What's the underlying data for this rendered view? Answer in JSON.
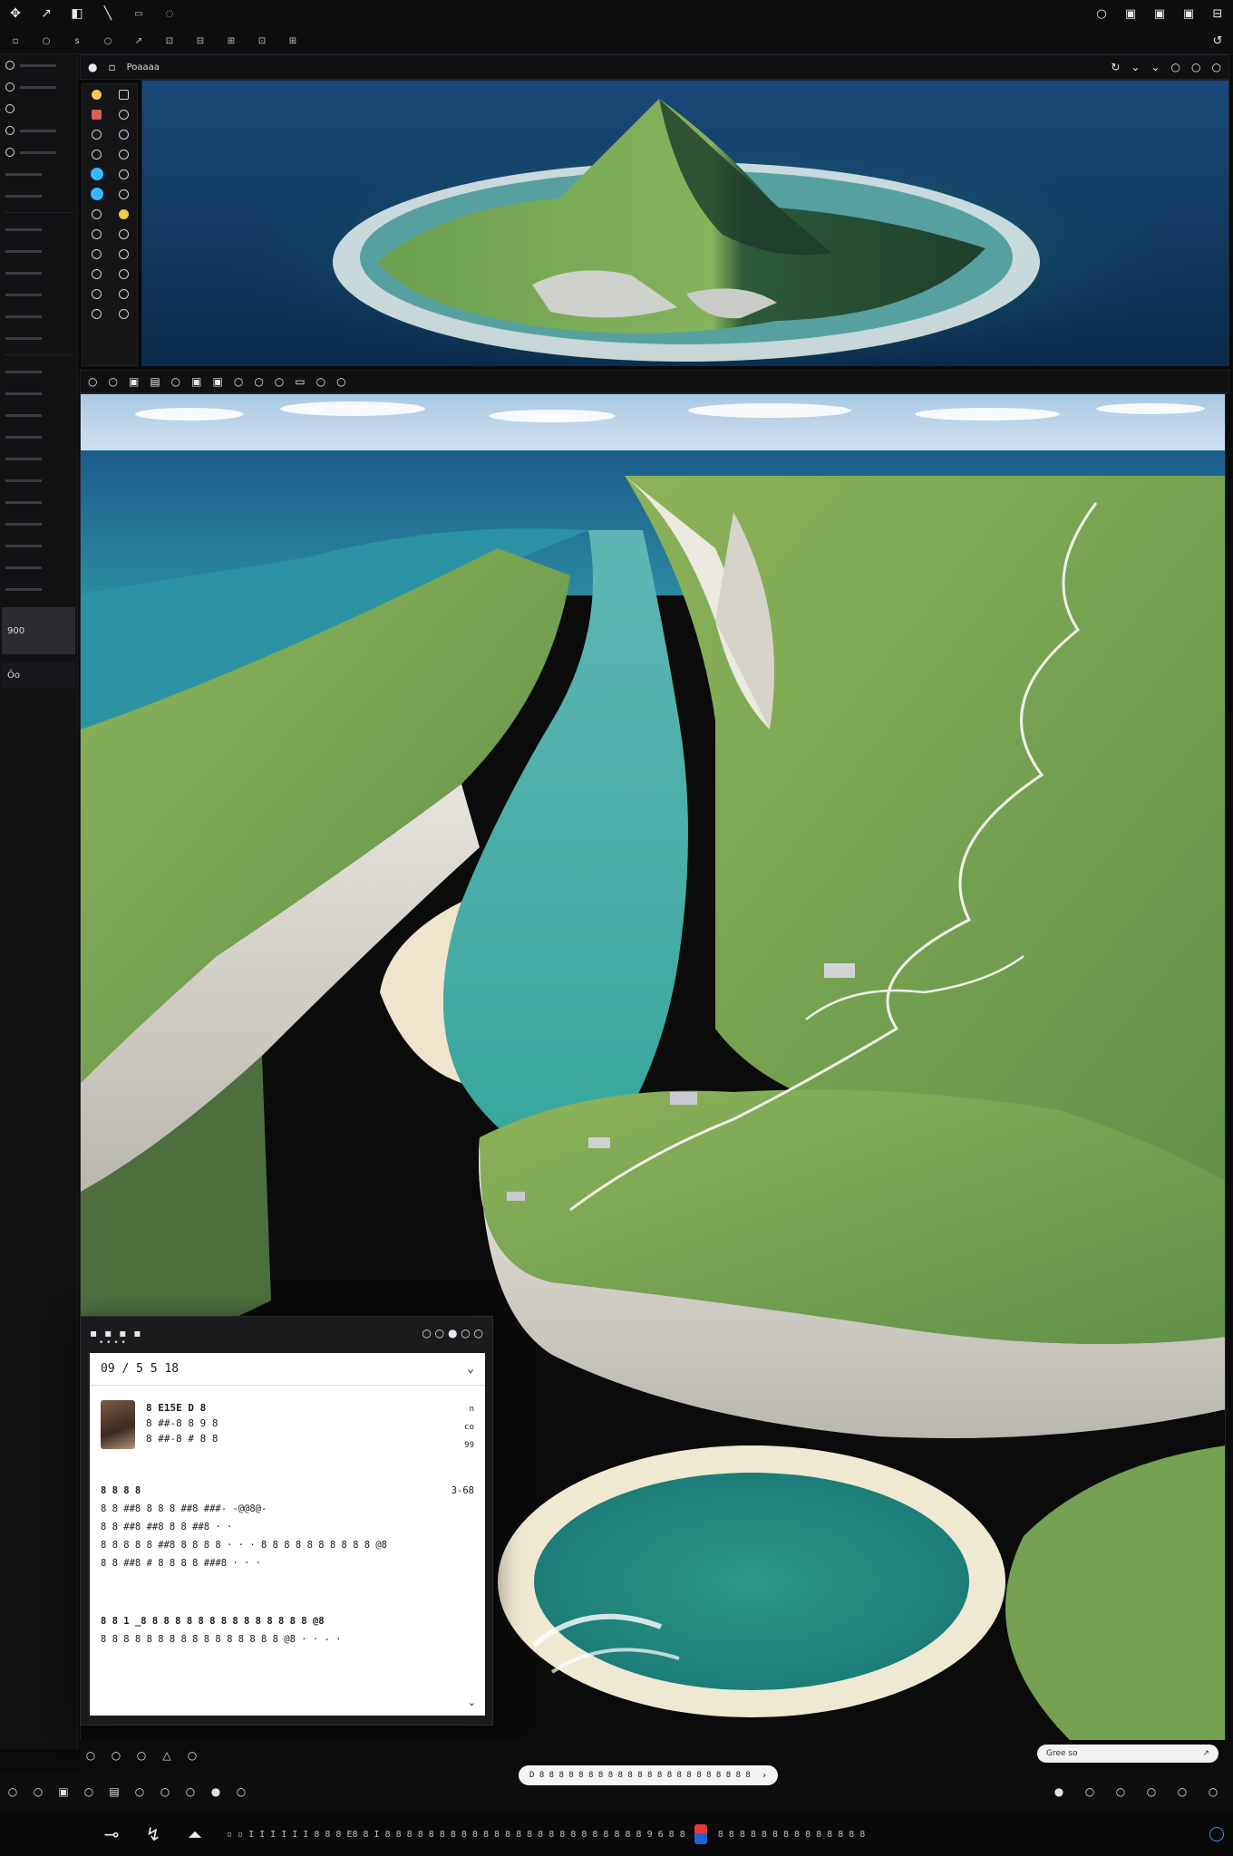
{
  "toolbar_top": {
    "row1_left": [
      "✥",
      "↗",
      "◧",
      "╲",
      "▭",
      "◌"
    ],
    "row1_right": [
      "○",
      "▣",
      "▣",
      "▣",
      "⊟"
    ],
    "row2_left": [
      "▫",
      "○",
      "s",
      "○",
      "↗",
      "⊡",
      "⊟",
      "⊞",
      "⊡",
      "⊞"
    ],
    "row2_right": [
      "↺"
    ]
  },
  "left_panel": {
    "rows": [
      "",
      "",
      "",
      "",
      "",
      "",
      "",
      "",
      "",
      "",
      "",
      "",
      "",
      "",
      "",
      "",
      ""
    ],
    "block1_label": "900",
    "block2_label": "Ôo"
  },
  "top_view": {
    "header_label": "Poaaaa",
    "description": "island aerial render"
  },
  "main_view": {
    "header_tools": [
      "○",
      "○",
      "▣",
      "▤",
      "○",
      "▣",
      "▣",
      "○",
      "○",
      "○",
      "▭",
      "○",
      "○"
    ]
  },
  "dialog": {
    "title_icons": [
      "▪",
      "▪",
      "▪",
      "▪"
    ],
    "title_right": "○ ○ ● ○ ○",
    "subtitle": "• • • •",
    "bar_left": "09 / 5 5 18",
    "bar_right": "⌄",
    "user_name": "8 E15E D 8",
    "user_line2": "8 ##-8 8 9 8",
    "user_line3": "8 ##-8 # 8 8",
    "user_meta_top": "n",
    "user_meta_mid": "co",
    "user_meta_bot": "99",
    "section_head": "8 8 8 8",
    "section_head_right": "3-68",
    "lines": [
      "8 8 ##8 8 8 8 ##8 ###- -@@8@-",
      "8 8 ##8 ##8 8 8 ##8 · ·",
      "8 8 8 8 8 ##8 8 8 8 8 ·  ·  · 8 8 8 8 8 8 8 8 8 8 @8",
      "8 8 ##8 # 8 8 8 8 ###8 · · ·"
    ],
    "lines2": [
      "8 8 1 _8 8 8 8 8 8 8 8 8 8 8 8 8 8 8 @8",
      "8 8 8 8 8 8 8 8 8 8 8 8 8 8 8 8 @8 · · - ·"
    ],
    "footer": "⌄"
  },
  "bottom_bar": {
    "left_icons": [
      "○",
      "○",
      "○",
      "△",
      "○"
    ],
    "search_text": "D 8 8 8 8 8 8 8 8 8 8 8 8 8 8 8 8 8 8 8 8 8 8",
    "search_chevron": "›",
    "zoom_text": "Gree  so",
    "zoom_end": "↗",
    "row2_left": [
      "○",
      "○",
      "▣",
      "○",
      "▤",
      "○",
      "○",
      "○",
      "●",
      "○"
    ],
    "row2_right": [
      "●",
      "○",
      "○",
      "○",
      "○",
      "○"
    ]
  },
  "status_bar": {
    "tools": [
      "⊸",
      "↯",
      "⏶"
    ],
    "text": "▫  ▫  I  I  I  I  I  I     8 8 8   E8 8   I   8 8 8 8 8 8 8   8 8 8 8 8 8   8 8 8 8 8 8 8   8 8 8   8 9 6   8 8",
    "text2": "8 8 8 8 8 8 8 8   8 8 8 8 8 8"
  },
  "colors": {
    "accent_blue": "#38b6ff",
    "accent_yellow": "#f2c94c",
    "accent_red": "#e53935"
  }
}
